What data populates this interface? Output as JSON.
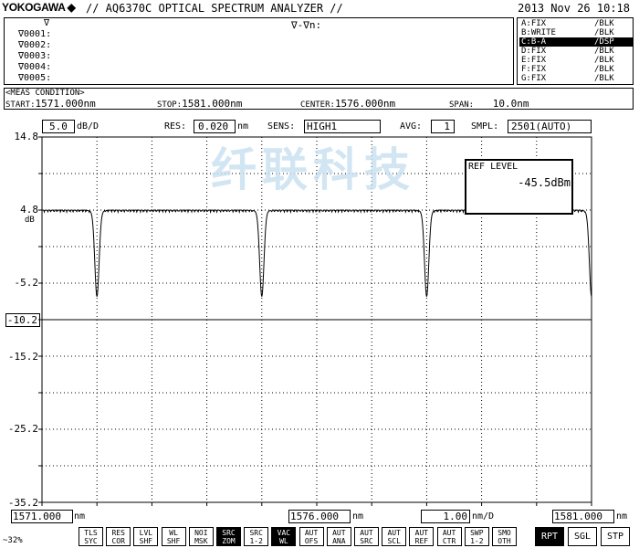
{
  "header": {
    "brand": "YOKOGAWA",
    "brand_mark": "◆",
    "title": "// AQ6370C OPTICAL SPECTRUM ANALYZER //",
    "datetime": "2013 Nov 26 10:18"
  },
  "markers": {
    "rows": [
      "∇",
      "∇0001:",
      "∇0002:",
      "∇0003:",
      "∇0004:",
      "∇0005:"
    ],
    "delta_label": "∇-∇n:"
  },
  "trace_table": [
    {
      "name": "A:FIX",
      "status": "/BLK",
      "active": false
    },
    {
      "name": "B:WRITE",
      "status": "/BLK",
      "active": false
    },
    {
      "name": "C:B-A",
      "status": "/DSP",
      "active": true
    },
    {
      "name": "D:FIX",
      "status": "/BLK",
      "active": false
    },
    {
      "name": "E:FIX",
      "status": "/BLK",
      "active": false
    },
    {
      "name": "F:FIX",
      "status": "/BLK",
      "active": false
    },
    {
      "name": "G:FIX",
      "status": "/BLK",
      "active": false
    }
  ],
  "meas_condition": {
    "title": "<MEAS CONDITION>",
    "start_label": "START:",
    "start_value": "1571.000nm",
    "stop_label": "STOP:",
    "stop_value": "1581.000nm",
    "center_label": "CENTER:",
    "center_value": "1576.000nm",
    "span_label": "SPAN:",
    "span_value": "10.0nm"
  },
  "settings": {
    "scale_value": "5.0",
    "scale_unit": "dB/D",
    "res_label": "RES:",
    "res_value": "0.020",
    "res_unit": "nm",
    "sens_label": "SENS:",
    "sens_value": "HIGH1",
    "avg_label": "AVG:",
    "avg_value": "1",
    "smpl_label": "SMPL:",
    "smpl_value": "2501(AUTO)"
  },
  "watermark": "纤联科技",
  "ref_level": {
    "label": "REF LEVEL",
    "value": "-45.5dBm"
  },
  "y_axis": {
    "ticks": [
      "14.8",
      "4.8",
      "-5.2",
      "-10.2",
      "-15.2",
      "-25.2",
      "-35.2"
    ],
    "unit": "dB",
    "ref_tick": "-10.2"
  },
  "x_axis": {
    "start": "1571.000",
    "center": "1576.000",
    "per_div": "1.00",
    "stop": "1581.000",
    "unit_nm": "nm",
    "unit_nmd": "nm/D"
  },
  "chart_data": {
    "type": "line",
    "title": "",
    "xlabel": "",
    "ylabel": "dB",
    "xlim": [
      1571.0,
      1581.0
    ],
    "ylim": [
      -35.2,
      14.8
    ],
    "grid": true,
    "series": [
      {
        "baseline_db": 4.8,
        "dips": [
          {
            "x": 1572.0,
            "y": -6.8
          },
          {
            "x": 1575.0,
            "y": -6.8
          },
          {
            "x": 1578.0,
            "y": -6.8
          },
          {
            "x": 1581.0,
            "y": -6.8
          }
        ]
      }
    ]
  },
  "footer": {
    "zoom_text": "~32%",
    "softkeys": [
      {
        "l1": "TLS",
        "l2": "SYC",
        "on": false
      },
      {
        "l1": "RES",
        "l2": "COR",
        "on": false
      },
      {
        "l1": "LVL",
        "l2": "SHF",
        "on": false
      },
      {
        "l1": "WL",
        "l2": "SHF",
        "on": false
      },
      {
        "l1": "NOI",
        "l2": "MSK",
        "on": false
      },
      {
        "l1": "SRC",
        "l2": "ZOM",
        "on": true
      },
      {
        "l1": "SRC",
        "l2": "1-2",
        "on": false
      },
      {
        "l1": "VAC",
        "l2": "WL",
        "on": true
      },
      {
        "l1": "AUT",
        "l2": "OFS",
        "on": false
      },
      {
        "l1": "AUT",
        "l2": "ANA",
        "on": false
      },
      {
        "l1": "AUT",
        "l2": "SRC",
        "on": false
      },
      {
        "l1": "AUT",
        "l2": "SCL",
        "on": false
      },
      {
        "l1": "AUT",
        "l2": "REF",
        "on": false
      },
      {
        "l1": "AUT",
        "l2": "CTR",
        "on": false
      },
      {
        "l1": "SWP",
        "l2": "1-2",
        "on": false
      },
      {
        "l1": "SMO",
        "l2": "OTH",
        "on": false
      }
    ],
    "sweep_buttons": [
      {
        "label": "RPT",
        "on": true
      },
      {
        "label": "SGL",
        "on": false
      },
      {
        "label": "STP",
        "on": false
      }
    ]
  }
}
